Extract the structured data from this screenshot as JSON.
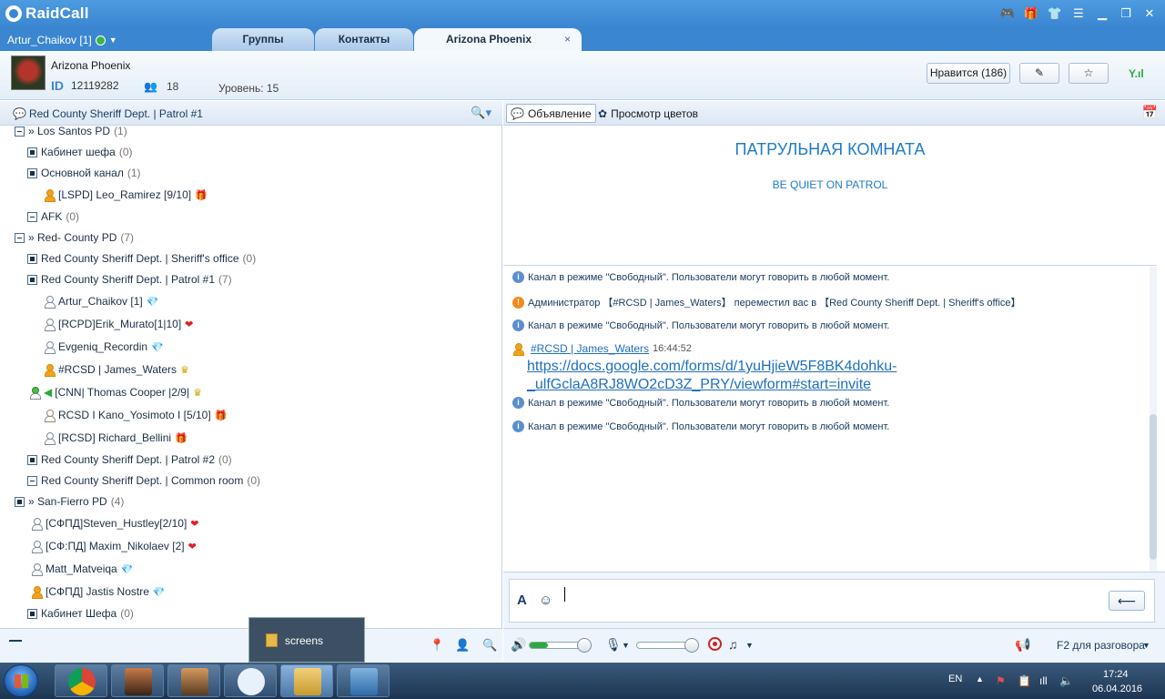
{
  "app": {
    "logo_text": "RaidCall",
    "user_status": "Artur_Chaikov [1]"
  },
  "tabs": [
    {
      "label": "Группы"
    },
    {
      "label": "Контакты"
    },
    {
      "label": "Arizona Phoenix",
      "close": "×"
    }
  ],
  "channel": {
    "name": "Arizona Phoenix",
    "id_label": "ID",
    "id_value": "12119282",
    "members": "18",
    "level": "Уровень: 15",
    "like_button": "Нравится (186)"
  },
  "left_panel": {
    "current_room": "Red County Sheriff Dept. | Patrol #1",
    "tree": [
      {
        "label": "» Los Santos PD",
        "count": "(1)"
      },
      {
        "label": "Кабинет шефа",
        "count": "(0)"
      },
      {
        "label": "Основной канал",
        "count": "(1)"
      },
      {
        "label": "[LSPD] Leo_Ramirez [9/10]"
      },
      {
        "label": "AFK",
        "count": "(0)"
      },
      {
        "label": "» Red- County PD",
        "count": "(7)"
      },
      {
        "label": "Red County Sheriff Dept. | Sheriff's office",
        "count": "(0)"
      },
      {
        "label": "Red County Sheriff Dept. | Patrol #1",
        "count": "(7)"
      },
      {
        "label": "Artur_Chaikov [1]"
      },
      {
        "label": "[RCPD]Erik_Murato[1|10]"
      },
      {
        "label": "Evgeniq_Recordin"
      },
      {
        "label": "#RCSD | James_Waters"
      },
      {
        "label": "[CNN| Thomas Cooper |2/9|"
      },
      {
        "label": "RCSD I Kano_Yosimoto I [5/10]"
      },
      {
        "label": "[RCSD] Richard_Bellini"
      },
      {
        "label": "Red County Sheriff Dept. | Patrol #2",
        "count": "(0)"
      },
      {
        "label": "Red County Sheriff Dept. |  Common room",
        "count": "(0)"
      },
      {
        "label": "» San-Fierro PD",
        "count": "(4)"
      },
      {
        "label": "[СФПД]Steven_Hustley[2/10]"
      },
      {
        "label": "[СФ:ПД] Maxim_Nikolaev [2]"
      },
      {
        "label": "Matt_Matveiqa"
      },
      {
        "label": "[СФПД] Jastis Nostre"
      },
      {
        "label": "Кабинет Шефа",
        "count": "(0)"
      }
    ]
  },
  "right_panel": {
    "announce_tab": "Объявление",
    "colors_tab": "Просмотр цветов",
    "announce_title": "ПАТРУЛЬНАЯ КОМНАТА",
    "announce_sub": "BE QUIET ON PATROL",
    "messages": [
      {
        "text": "Канал в режиме \"Свободный\". Пользователи могут говорить в любой момент."
      },
      {
        "text": "Администратор 【#RCSD | James_Waters】 переместил вас в 【Red County Sheriff Dept. | Sheriff's office】"
      },
      {
        "text": "Канал в режиме \"Свободный\". Пользователи могут говорить в любой момент."
      },
      {
        "text": "Канал в режиме \"Свободный\". Пользователи могут говорить в любой момент."
      },
      {
        "text": "Канал в режиме \"Свободный\". Пользователи могут говорить в любой момент."
      }
    ],
    "chat_user": "#RCSD | James_Waters",
    "chat_time": "16:44:52",
    "chat_link": "https://docs.google.com/forms/d/1yuHjieW5F8BK4dohku-_ulfGclaA8RJ8WO2cD3Z_PRY/viewform#start=invite",
    "f2_label": "F2 для разговора"
  },
  "popup": {
    "label": "screens"
  },
  "taskbar": {
    "lang": "EN",
    "time": "17:24",
    "date": "06.04.2016"
  }
}
